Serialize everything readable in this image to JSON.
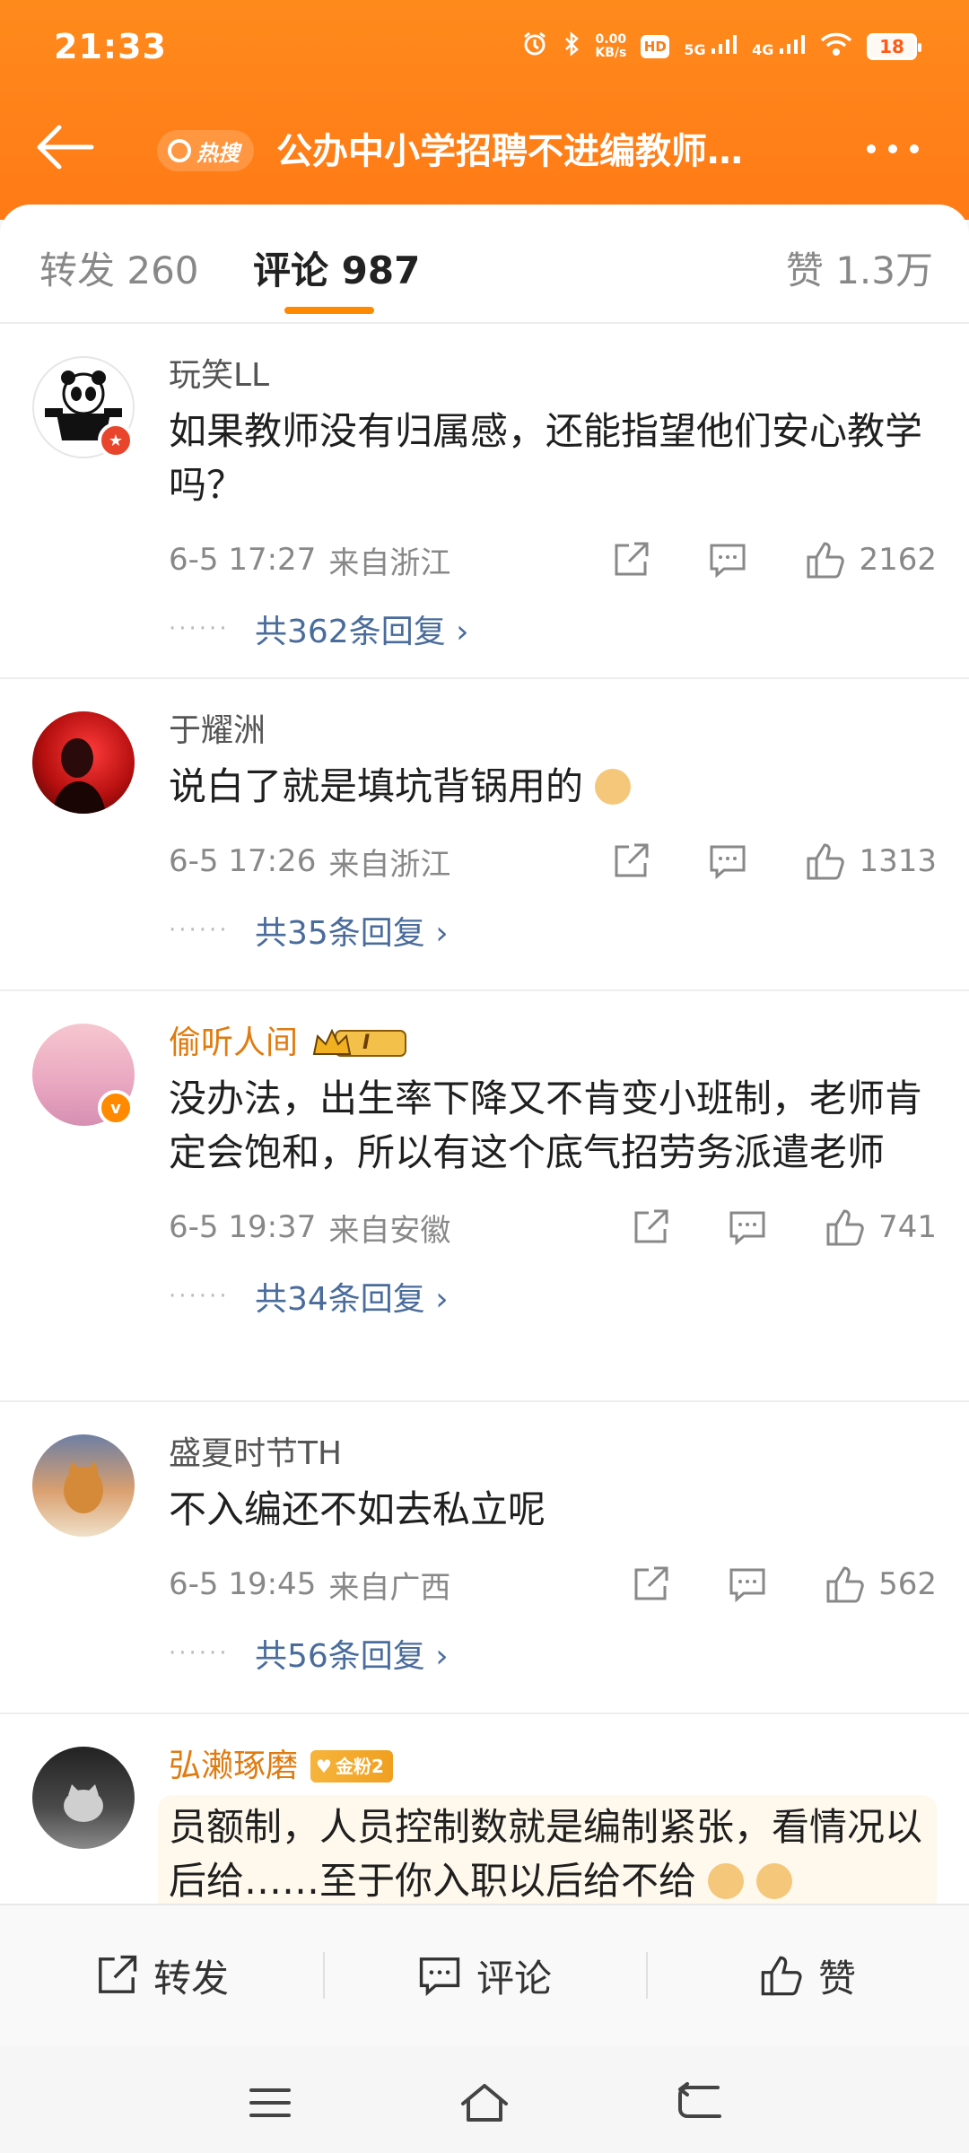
{
  "status_bar": {
    "time": "21:33",
    "speed_value": "0.00",
    "speed_unit": "KB/s",
    "hd_label": "HD",
    "net_5g": "5G",
    "net_4g": "4G",
    "battery": "18"
  },
  "nav": {
    "hot_badge": "热搜",
    "title": "公办中小学招聘不进编教师…"
  },
  "tabs": {
    "repost": "转发 260",
    "comments": "评论 987",
    "likes": "赞 1.3万"
  },
  "comments": [
    {
      "user": "玩笑LL",
      "text": "如果教师没有归属感，还能指望他们安心教学吗？",
      "date": "6-5 17:27",
      "location": "来自浙江",
      "likes": "2162",
      "replies": "共362条回复 ›"
    },
    {
      "user": "于耀洲",
      "text": "说白了就是填坑背锅用的",
      "date": "6-5 17:26",
      "location": "来自浙江",
      "likes": "1313",
      "replies": "共35条回复 ›"
    },
    {
      "user": "偷听人间",
      "vip_level": "I",
      "text": "没办法，出生率下降又不肯变小班制，老师肯定会饱和，所以有这个底气招劳务派遣老师",
      "date": "6-5 19:37",
      "location": "来自安徽",
      "likes": "741",
      "replies": "共34条回复 ›"
    },
    {
      "user": "盛夏时节TH",
      "text": "不入编还不如去私立呢",
      "date": "6-5 19:45",
      "location": "来自广西",
      "likes": "562",
      "replies": "共56条回复 ›"
    },
    {
      "user": "弘濑琢磨",
      "fan_badge": "金粉2",
      "text": "员额制，人员控制数就是编制紧张，看情况以后给……至于你入职以后给不给"
    }
  ],
  "bottom_bar": {
    "repost": "转发",
    "comment": "评论",
    "like": "赞"
  },
  "colors": {
    "brand_orange": "#ff8a1c",
    "link_blue": "#4a6c9c",
    "gold_name": "#e07b10"
  }
}
